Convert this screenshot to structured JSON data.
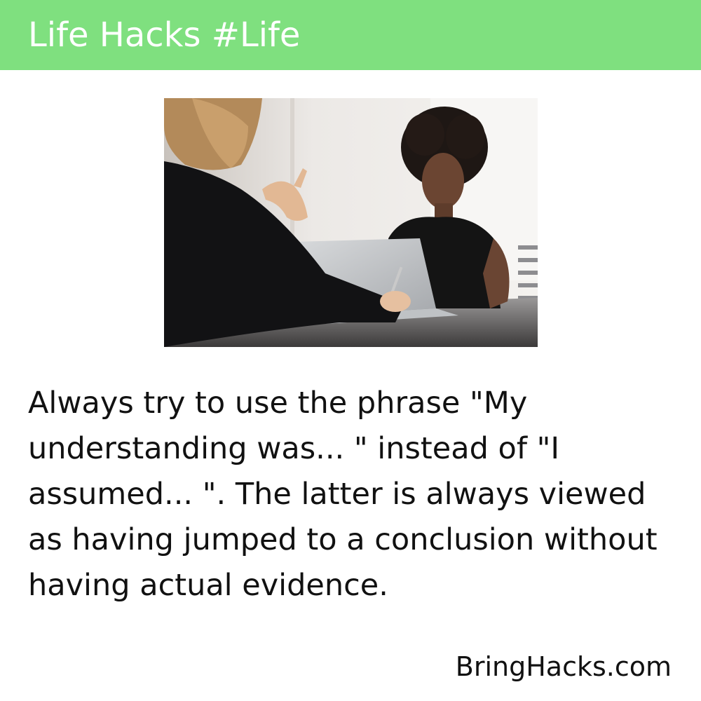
{
  "header": {
    "title": "Life Hacks #Life",
    "color": "#7fe07f"
  },
  "photo": {
    "subject": "two women talking across a desk with a laptop"
  },
  "content": {
    "text": "Always try to use the phrase \"My understanding was... \" instead of \"I assumed... \". The latter is always viewed as having jumped to a conclusion without having actual evidence."
  },
  "footer": {
    "site": "BringHacks.com"
  }
}
